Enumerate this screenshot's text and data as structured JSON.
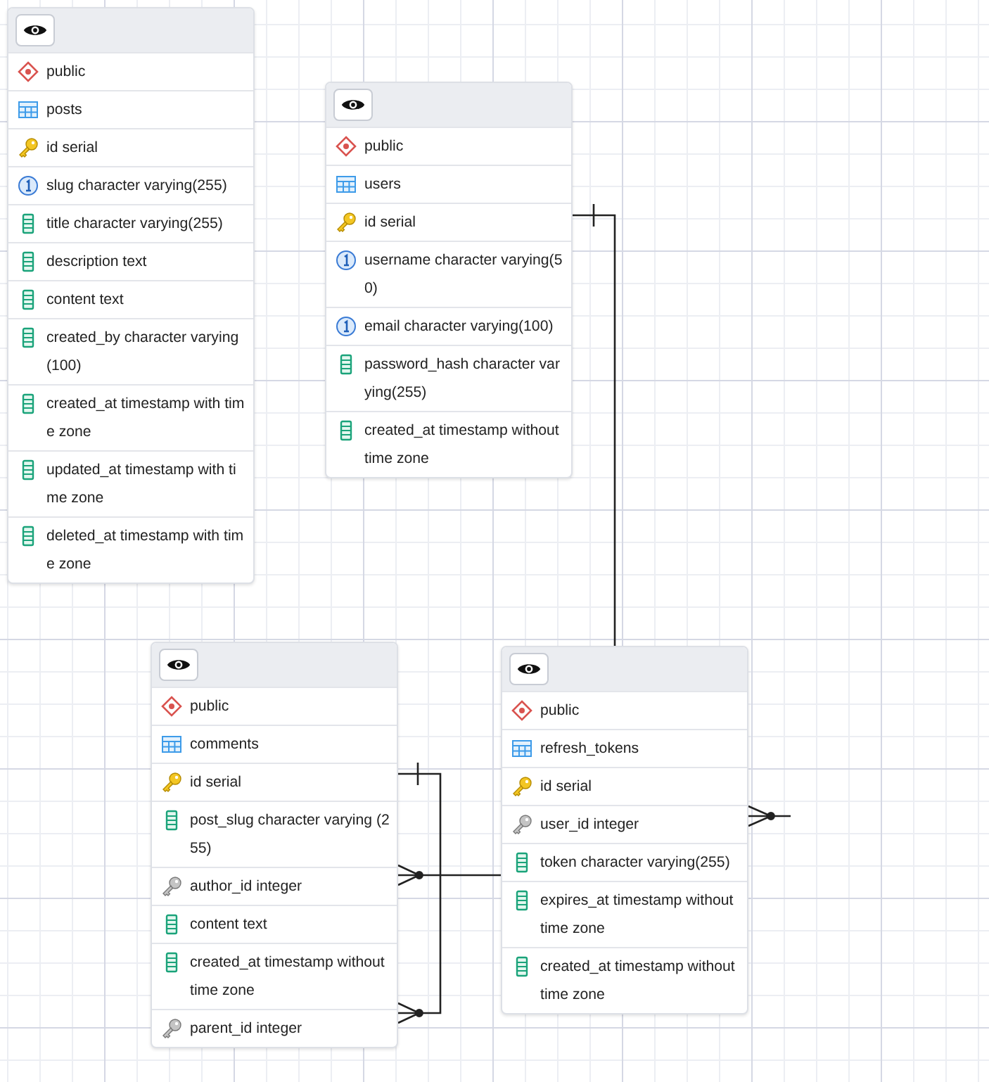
{
  "tables": [
    {
      "rows": [
        {
          "kind": "schema",
          "text": "public"
        },
        {
          "kind": "table",
          "text": "posts"
        },
        {
          "kind": "pk",
          "text": "id serial"
        },
        {
          "kind": "unique",
          "text": "slug character varying(255)"
        },
        {
          "kind": "column",
          "text": "title character varying(255)"
        },
        {
          "kind": "column",
          "text": "description text"
        },
        {
          "kind": "column",
          "text": "content text"
        },
        {
          "kind": "column",
          "text": "created_by character varying(100)"
        },
        {
          "kind": "column",
          "text": "created_at timestamp with time zone"
        },
        {
          "kind": "column",
          "text": "updated_at timestamp with time zone"
        },
        {
          "kind": "column",
          "text": "deleted_at timestamp with time zone"
        }
      ]
    },
    {
      "rows": [
        {
          "kind": "schema",
          "text": "public"
        },
        {
          "kind": "table",
          "text": "users"
        },
        {
          "kind": "pk",
          "text": "id serial"
        },
        {
          "kind": "unique",
          "text": "username character varying(50)"
        },
        {
          "kind": "unique",
          "text": "email character varying(100)"
        },
        {
          "kind": "column",
          "text": "password_hash character varying(255)"
        },
        {
          "kind": "column",
          "text": "created_at timestamp without time zone"
        }
      ]
    },
    {
      "rows": [
        {
          "kind": "schema",
          "text": "public"
        },
        {
          "kind": "table",
          "text": "comments"
        },
        {
          "kind": "pk",
          "text": "id serial"
        },
        {
          "kind": "column",
          "text": "post_slug character varying (255)"
        },
        {
          "kind": "fk",
          "text": "author_id integer"
        },
        {
          "kind": "column",
          "text": "content text"
        },
        {
          "kind": "column",
          "text": "created_at timestamp without time zone"
        },
        {
          "kind": "fk",
          "text": "parent_id integer"
        }
      ]
    },
    {
      "rows": [
        {
          "kind": "schema",
          "text": "public"
        },
        {
          "kind": "table",
          "text": "refresh_tokens"
        },
        {
          "kind": "pk",
          "text": "id serial"
        },
        {
          "kind": "fk",
          "text": "user_id integer"
        },
        {
          "kind": "column",
          "text": "token character varying(255)"
        },
        {
          "kind": "column",
          "text": "expires_at timestamp without time zone"
        },
        {
          "kind": "column",
          "text": "created_at timestamp without time zone"
        }
      ]
    }
  ]
}
